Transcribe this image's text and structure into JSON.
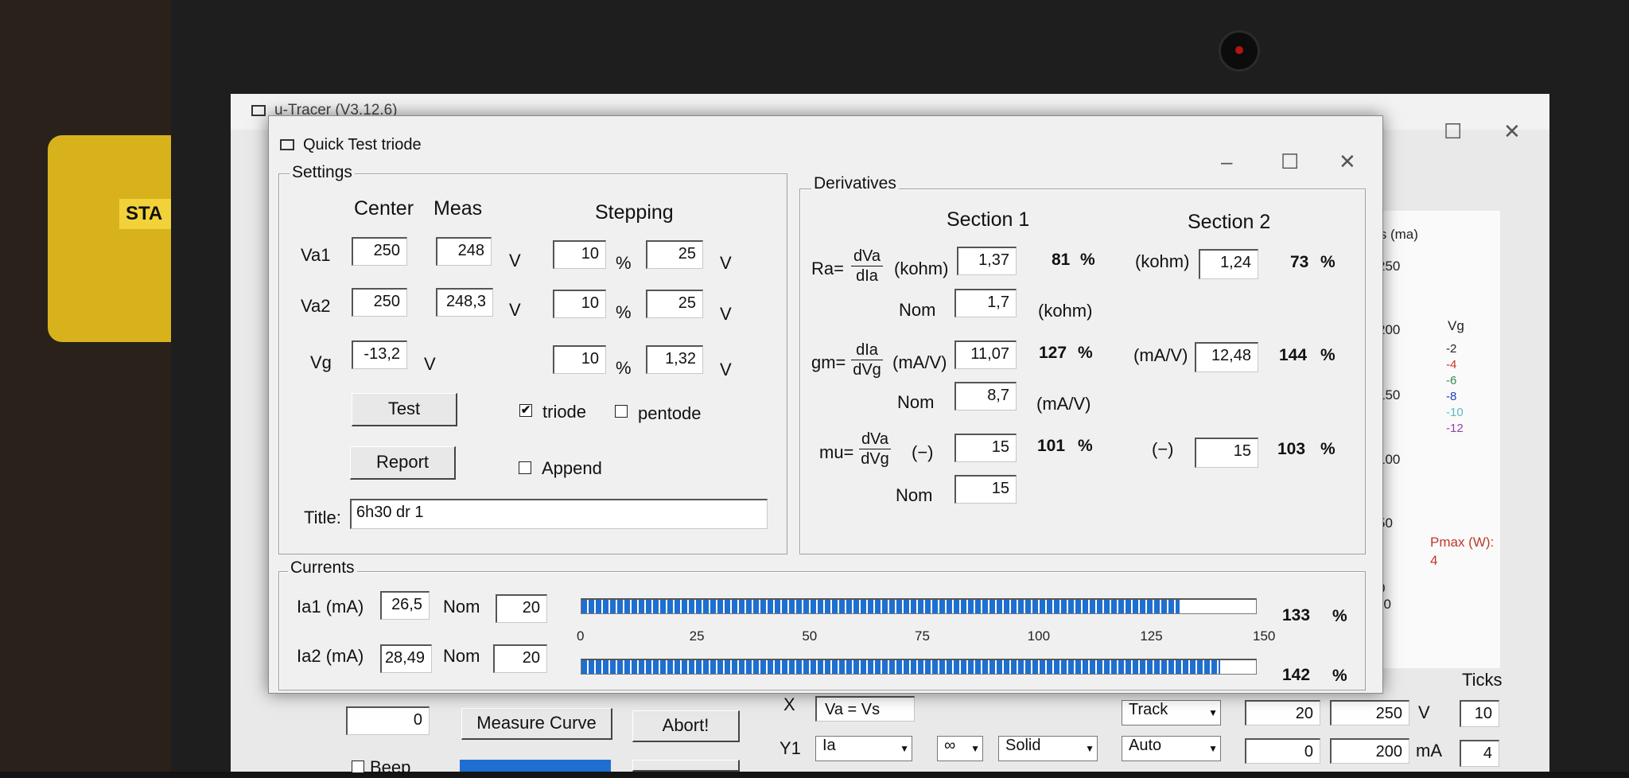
{
  "main_window": {
    "title": "u-Tracer (V3.12.6)",
    "graph": {
      "y_label": "Is (ma)",
      "y_ticks": [
        "250",
        "200",
        "150",
        "100",
        "50",
        "0"
      ],
      "legend_title": "Vg",
      "legend": [
        {
          "label": "-2",
          "color": "#222222"
        },
        {
          "label": "-4",
          "color": "#c0392b"
        },
        {
          "label": "-6",
          "color": "#2e8b57"
        },
        {
          "label": "-8",
          "color": "#1f3fbf"
        },
        {
          "label": "-10",
          "color": "#5fb8c8"
        },
        {
          "label": "-12",
          "color": "#8e44ad"
        }
      ],
      "pmax_label": "Pmax (W):",
      "pmax_value": "4",
      "x_fragment": "50"
    },
    "bottom": {
      "field_value": "0",
      "measure_curve_label": "Measure Curve",
      "abort_label": "Abort!",
      "beep_label": "Beep",
      "x_label": "X",
      "x_value": "Va = Vs",
      "y1_label": "Y1",
      "y1_value": "Ia",
      "y1_marker": "∞",
      "line_style": "Solid",
      "x_mode": "Track",
      "y_mode": "Auto",
      "x_min": "20",
      "x_max": "250",
      "x_unit": "V",
      "y_min": "0",
      "y_max": "200",
      "y_unit": "mA",
      "ticks_label": "Ticks",
      "x_ticks": "10",
      "y_ticks": "4",
      "x_fragment": "x"
    }
  },
  "dialog": {
    "title": "Quick Test triode",
    "settings": {
      "legend": "Settings",
      "col_center": "Center",
      "col_meas": "Meas",
      "col_stepping": "Stepping",
      "va1": {
        "label": "Va1",
        "center": "250",
        "meas": "248",
        "unit": "V",
        "step_pct": "10",
        "pct": "%",
        "step_val": "25",
        "step_unit": "V"
      },
      "va2": {
        "label": "Va2",
        "center": "250",
        "meas": "248,3",
        "unit": "V",
        "step_pct": "10",
        "pct": "%",
        "step_val": "25",
        "step_unit": "V"
      },
      "vg": {
        "label": "Vg",
        "center": "-13,2",
        "unit": "V",
        "step_pct": "10",
        "pct": "%",
        "step_val": "1,32",
        "step_unit": "V"
      },
      "test_label": "Test",
      "report_label": "Report",
      "triode_label": "triode",
      "triode_checked": "✔",
      "pentode_label": "pentode",
      "append_label": "Append",
      "title_label": "Title:",
      "title_value": "6h30 dr 1"
    },
    "derivatives": {
      "legend": "Derivatives",
      "section1": "Section 1",
      "section2": "Section 2",
      "ra": {
        "label": "Ra=",
        "num": "dVa",
        "den": "dIa",
        "unit": "(kohm)",
        "s1": "1,37",
        "s1_pct": "81",
        "s2_unit": "(kohm)",
        "s2": "1,24",
        "s2_pct": "73",
        "nom_label": "Nom",
        "nom": "1,7",
        "nom_unit": "(kohm)"
      },
      "gm": {
        "label": "gm=",
        "num": "dIa",
        "den": "dVg",
        "unit": "(mA/V)",
        "s1": "11,07",
        "s1_pct": "127",
        "s2_unit": "(mA/V)",
        "s2": "12,48",
        "s2_pct": "144",
        "nom_label": "Nom",
        "nom": "8,7",
        "nom_unit": "(mA/V)"
      },
      "mu": {
        "label": "mu=",
        "num": "dVa",
        "den": "dVg",
        "unit": "(−)",
        "s1": "15",
        "s1_pct": "101",
        "s2_unit": "(−)",
        "s2": "15",
        "s2_pct": "103",
        "nom_label": "Nom",
        "nom": "15"
      },
      "pct": "%"
    },
    "currents": {
      "legend": "Currents",
      "ia1": {
        "label": "Ia1 (mA)",
        "value": "26,5",
        "nom_label": "Nom",
        "nom": "20",
        "percent": 133,
        "pct_text": "133",
        "pct": "%"
      },
      "ia2": {
        "label": "Ia2 (mA)",
        "value": "28,49",
        "nom_label": "Nom",
        "nom": "20",
        "percent": 142,
        "pct_text": "142",
        "pct": "%"
      },
      "scale": [
        "0",
        "25",
        "50",
        "75",
        "100",
        "125",
        "150"
      ],
      "scale_max": 150
    }
  }
}
